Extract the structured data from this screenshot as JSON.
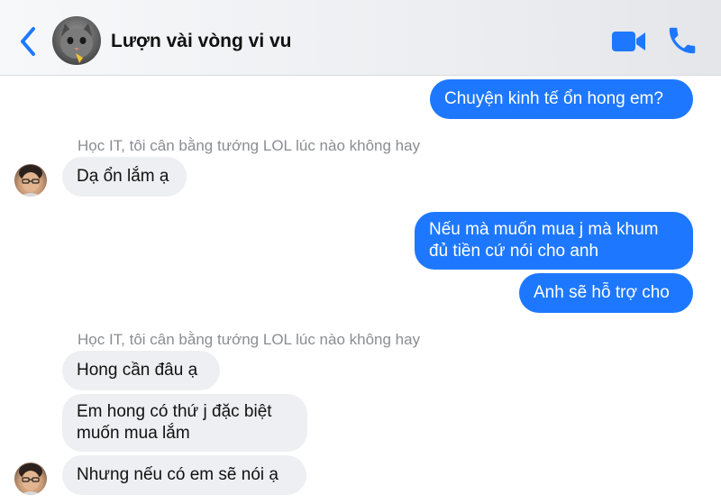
{
  "header": {
    "title": "Lượn vài vòng vi vu",
    "back_icon": "chevron-left-icon",
    "video_icon": "video-camera-icon",
    "call_icon": "phone-icon",
    "accent_color": "#1e78ff"
  },
  "messages": {
    "m1": "Chuyện kinh tế ổn hong em?",
    "sender1": "Học IT, tôi cân bằng tướng LOL lúc nào không hay",
    "m2": "Dạ ổn lắm ạ",
    "m3_line1": "Nếu mà muốn mua j mà khum",
    "m3_line2": "đủ tiền cứ nói cho anh",
    "m4": "Anh sẽ hỗ trợ cho",
    "sender2": "Học IT, tôi cân bằng tướng LOL lúc nào không hay",
    "m5": "Hong cần đâu ạ",
    "m6_line1": "Em hong có thứ j đặc biệt",
    "m6_line2": "muốn mua lắm",
    "m7": "Nhưng nếu có em sẽ nói ạ"
  },
  "colors": {
    "outgoing_bubble": "#1e78ff",
    "incoming_bubble": "#eeeff2",
    "sender_name": "#8b8d92"
  }
}
